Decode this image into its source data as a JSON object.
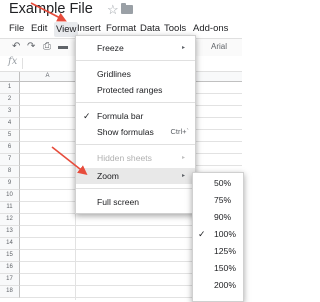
{
  "title_bar": {
    "title": "Example File",
    "star_icon": "star-icon",
    "folder_icon": "folder-icon"
  },
  "menu_bar": {
    "items": [
      {
        "label": "File"
      },
      {
        "label": "Edit"
      },
      {
        "label": "View"
      },
      {
        "label": "Insert"
      },
      {
        "label": "Format"
      },
      {
        "label": "Data"
      },
      {
        "label": "Tools"
      },
      {
        "label": "Add-ons"
      }
    ]
  },
  "toolbar": {
    "undo_icon": "undo-icon",
    "redo_icon": "redo-icon",
    "print_icon": "print-icon",
    "paint_format_icon": "paint-format-icon",
    "font": "Arial"
  },
  "formula_bar": {
    "fx": "fx"
  },
  "grid": {
    "columns": [
      "A"
    ],
    "rows": [
      "1",
      "2",
      "3",
      "4",
      "5",
      "6",
      "7",
      "8",
      "9",
      "10",
      "11",
      "12",
      "13",
      "14",
      "15",
      "16",
      "17",
      "18"
    ]
  },
  "view_menu": {
    "freeze": "Freeze",
    "gridlines": "Gridlines",
    "protected_ranges": "Protected ranges",
    "formula_bar": "Formula bar",
    "show_formulas": "Show formulas",
    "show_formulas_shortcut": "Ctrl+`",
    "hidden_sheets": "Hidden sheets",
    "zoom": "Zoom",
    "full_screen": "Full screen",
    "arrow": "▸",
    "check": "✓"
  },
  "zoom_menu": {
    "options": [
      "50%",
      "75%",
      "90%",
      "100%",
      "125%",
      "150%",
      "200%"
    ],
    "selected": "100%"
  },
  "colors": {
    "annotation_arrow": "#e74c3c",
    "menu_hover": "#e8e8e8"
  }
}
